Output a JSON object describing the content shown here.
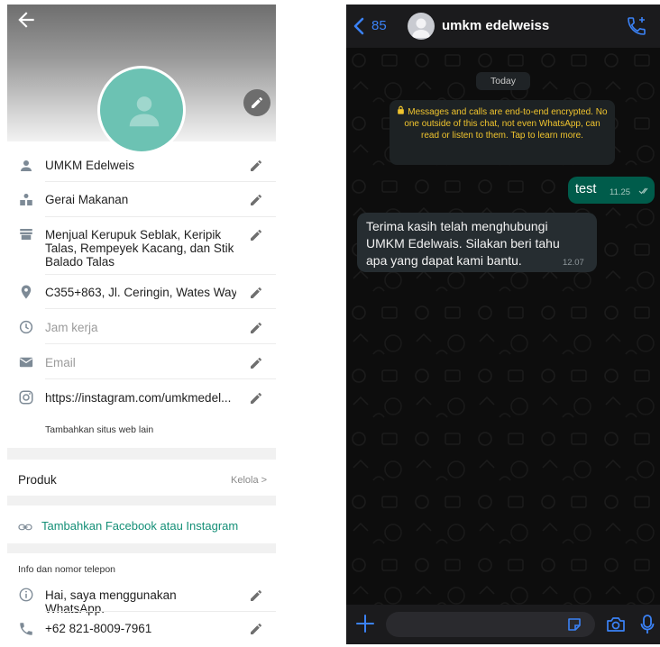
{
  "profile": {
    "fields": [
      {
        "icon": "person-icon",
        "text": "UMKM Edelweis",
        "placeholder": false
      },
      {
        "icon": "store-category-icon",
        "text": "Gerai Makanan",
        "placeholder": false
      },
      {
        "icon": "shop-icon",
        "text": "Menjual Kerupuk Seblak, Keripik Talas, Rempeyek Kacang, dan Stik Balado Talas",
        "placeholder": false
      },
      {
        "icon": "location-pin-icon",
        "text": "C355+863, Jl. Ceringin, Wates Way...",
        "placeholder": false
      },
      {
        "icon": "clock-icon",
        "text": "Jam kerja",
        "placeholder": true
      },
      {
        "icon": "email-icon",
        "text": "Email",
        "placeholder": true
      },
      {
        "icon": "instagram-icon",
        "text": "https://instagram.com/umkmedel...",
        "placeholder": false
      }
    ],
    "add_website_label": "Tambahkan situs web lain",
    "products_label": "Produk",
    "manage_label": "Kelola >",
    "add_social_label": "Tambahkan Facebook atau Instagram",
    "info_header": "Info dan nomor telepon",
    "about": "Hai, saya menggunakan WhatsApp.",
    "phone": "+62 821-8009-7961"
  },
  "chat": {
    "back_count": "85",
    "contact_name": "umkm edelweiss",
    "date_label": "Today",
    "encryption_notice": "Messages and calls are end-to-end encrypted. No one outside of this chat, not even WhatsApp, can read or listen to them. Tap to learn more.",
    "messages": [
      {
        "direction": "out",
        "text": "test",
        "time": "11.25"
      },
      {
        "direction": "in",
        "text": "Terima kasih telah menghubungi UMKM Edelwais. Silakan beri tahu apa yang dapat kami bantu.",
        "time": "12.07"
      }
    ],
    "input_placeholder": ""
  },
  "colors": {
    "accent_green": "#148f77",
    "avatar_teal": "#6cc2b3",
    "ios_blue": "#3b82f6",
    "outgoing_bubble": "#005c4b",
    "incoming_bubble": "#262d31",
    "encryption_text": "#f0c42e"
  }
}
